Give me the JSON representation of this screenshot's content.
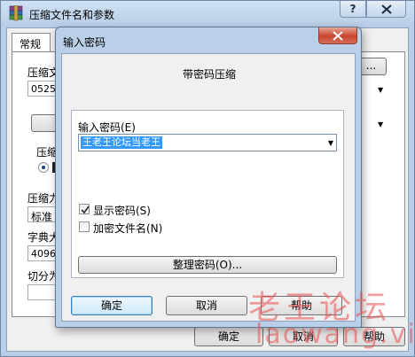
{
  "back_window": {
    "title": "压缩文件名和参数",
    "help_label": "?",
    "tab_general": "常规",
    "archive_name_label": "压缩文",
    "archive_name_value": "0525",
    "browse_label": "...",
    "update_mode_label": "压缩",
    "compression_method_label": "压缩力",
    "compression_method_value": "标准",
    "dictionary_label": "字典大",
    "dictionary_value": "4096",
    "split_label": "切分为",
    "ok_label": "确定",
    "cancel_label": "取消",
    "help_button_label": "帮助"
  },
  "dialog": {
    "title": "输入密码",
    "heading": "带密码压缩",
    "password_label": "输入密码(E)",
    "password_value": "王老王论坛当老王",
    "show_password_label": "显示密码(S)",
    "show_password_checked": true,
    "encrypt_names_label": "加密文件名(N)",
    "encrypt_names_checked": false,
    "organize_label": "整理密码(O)...",
    "ok_label": "确定",
    "cancel_label": "取消",
    "help_label": "帮助"
  },
  "watermark": {
    "line1": "老王论坛",
    "line2": "laowang.vip"
  },
  "colors": {
    "title_bar": "#b9cfe6",
    "close_red": "#c7452f",
    "selection": "#3399ff",
    "watermark": "#e84e4e"
  }
}
